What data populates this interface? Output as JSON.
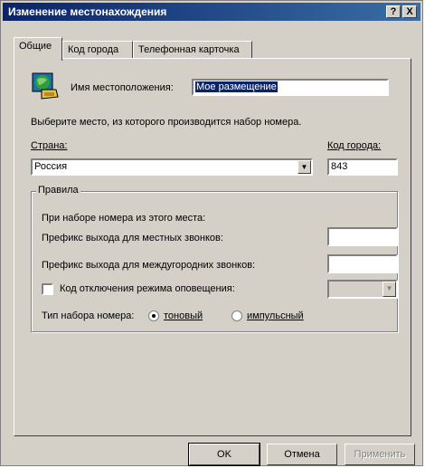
{
  "window": {
    "title": "Изменение местонахождения",
    "help_btn": "?",
    "close_btn": "X"
  },
  "tabs": [
    {
      "label": "Общие"
    },
    {
      "label": "Код города"
    },
    {
      "label": "Телефонная карточка"
    }
  ],
  "general": {
    "location_icon": "phone-globe-icon",
    "location_name_label": "Имя местоположения:",
    "location_name_value": "Мое размещение",
    "choose_place_text": "Выберите место, из которого производится набор номера.",
    "country_label": "Страна:",
    "country_value": "Россия",
    "area_code_label": "Код города:",
    "area_code_value": "843"
  },
  "rules": {
    "group_label": "Правила",
    "intro": "При наборе номера из этого места:",
    "local_prefix_label": "Префикс выхода для местных звонков:",
    "local_prefix_value": "",
    "long_prefix_label": "Префикс выхода для междугородних звонков:",
    "long_prefix_value": "",
    "call_waiting_label": "Код отключения режима оповещения:",
    "call_waiting_checked": false,
    "dial_type_label": "Тип набора номера:",
    "tone_label": "тоновый",
    "pulse_label": "импульсный",
    "selected_dial_type": "tone"
  },
  "buttons": {
    "ok": "OK",
    "cancel": "Отмена",
    "apply": "Применить"
  }
}
